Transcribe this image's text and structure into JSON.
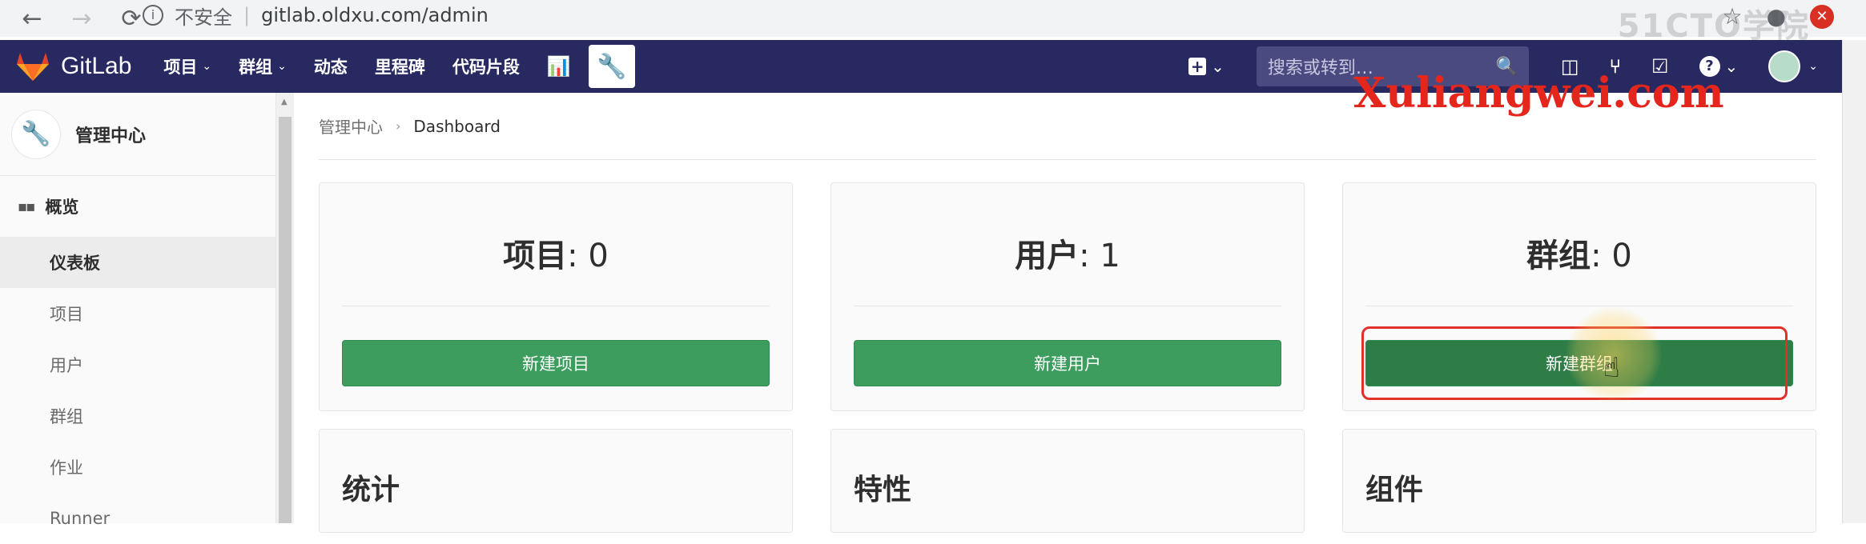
{
  "browser": {
    "back": "←",
    "forward": "→",
    "reload": "⟳",
    "info_icon": "i",
    "security": "不安全",
    "separator": "|",
    "url": "gitlab.oldxu.com/admin",
    "star": "☆",
    "account": "●",
    "ext": "✕",
    "top_watermark": "51CTO学院"
  },
  "nav": {
    "brand": "GitLab",
    "items": [
      {
        "label": "项目",
        "caret": "⌄"
      },
      {
        "label": "群组",
        "caret": "⌄"
      },
      {
        "label": "动态"
      },
      {
        "label": "里程碑"
      },
      {
        "label": "代码片段"
      }
    ],
    "chart_icon": "📊",
    "wrench_icon": "🔧",
    "plus": "+",
    "caret": "⌄",
    "search_placeholder": "搜索或转到…",
    "search_icon": "🔍",
    "icons": {
      "todo_panel": "◫",
      "merge": "⑂",
      "checklist": "☑"
    },
    "help": "?"
  },
  "sidebar": {
    "header_icon": "🔧",
    "title": "管理中心",
    "group_icon": "▪▪",
    "group": "概览",
    "items": [
      {
        "label": "仪表板",
        "active": true
      },
      {
        "label": "项目"
      },
      {
        "label": "用户"
      },
      {
        "label": "群组"
      },
      {
        "label": "作业"
      },
      {
        "label": "Runner"
      }
    ],
    "scroll_arrow": "▲"
  },
  "breadcrumb": {
    "root": "管理中心",
    "chev": "›",
    "current": "Dashboard"
  },
  "cards": [
    {
      "label": "项目",
      "value": ": 0",
      "button": "新建项目"
    },
    {
      "label": "用户",
      "value": ": 1",
      "button": "新建用户"
    },
    {
      "label": "群组",
      "value": ": 0",
      "button": "新建群组"
    }
  ],
  "sections": [
    "统计",
    "特性",
    "组件"
  ],
  "watermark": "Xuliangwei.com",
  "cursor": "☝"
}
